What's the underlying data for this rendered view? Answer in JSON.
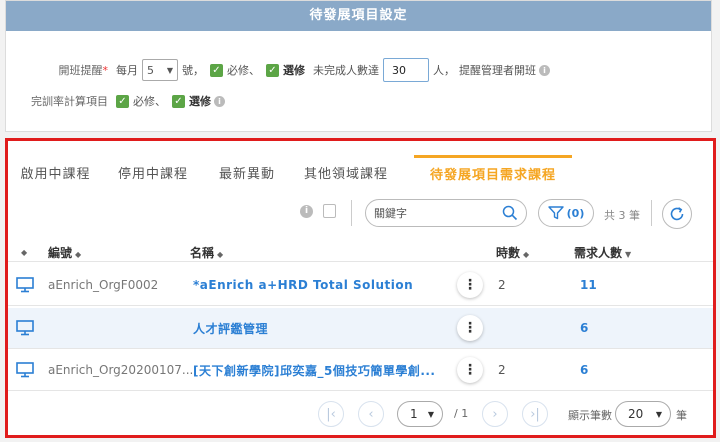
{
  "settings": {
    "title": "待發展項目設定",
    "row1": {
      "label": "開班提醒",
      "required_mark": "*",
      "monthly": "每月",
      "day_value": "5",
      "day_suffix": "號，",
      "required_course": "必修、",
      "elective_course": "選修",
      "uncompleted_label": "未完成人數達",
      "count_value": "30",
      "people_suffix": "人，",
      "remind_text": "提醒管理者開班"
    },
    "row2": {
      "label": "完訓率計算項目",
      "required_course": "必修、",
      "elective_course": "選修"
    }
  },
  "tabs": [
    {
      "label": "啟用中課程"
    },
    {
      "label": "停用中課程"
    },
    {
      "label": "最新異動"
    },
    {
      "label": "其他領域課程"
    },
    {
      "label": "待發展項目需求課程"
    }
  ],
  "toolbar": {
    "search_placeholder": "關鍵字",
    "filter_label": "(0)",
    "total_text": "共 3 筆"
  },
  "table": {
    "headers": {
      "code": "編號",
      "name": "名稱",
      "hours": "時數",
      "demand": "需求人數"
    },
    "rows": [
      {
        "code": "aEnrich_OrgF0002",
        "name": "*aEnrich a+HRD Total Solution",
        "hours": "2",
        "demand": "11"
      },
      {
        "code": "",
        "name": "人才評鑑管理",
        "hours": "",
        "demand": "6"
      },
      {
        "code": "aEnrich_Org20200107...",
        "name": "[天下創新學院]邱奕嘉_5個技巧簡單學創...",
        "hours": "2",
        "demand": "6"
      }
    ]
  },
  "pagination": {
    "current_page": "1",
    "total_pages": "/ 1",
    "page_size_label": "顯示筆數",
    "page_size": "20",
    "page_size_suffix": "筆"
  },
  "colors": {
    "accent": "#f5a623",
    "link": "#2b7fd4",
    "check": "#5ca546",
    "highlight_border": "#e01c1c"
  }
}
